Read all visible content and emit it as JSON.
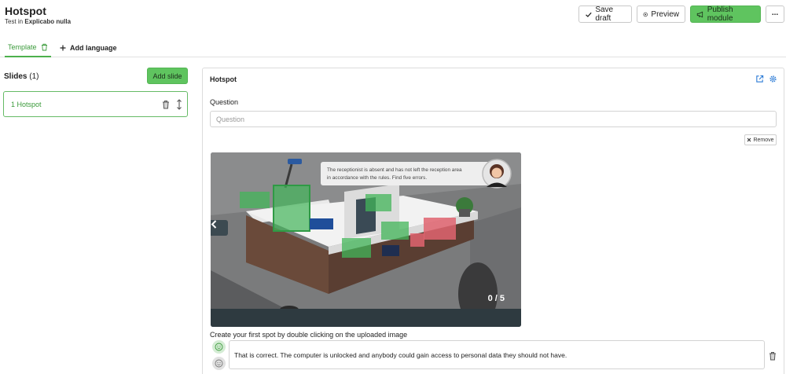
{
  "header": {
    "title": "Hotspot",
    "subtitle_prefix": "Test in",
    "subtitle_course": "Explicabo nulla",
    "save_draft": "Save draft",
    "preview": "Preview",
    "publish": "Publish module",
    "more": "..."
  },
  "tabs": {
    "template": "Template",
    "add_language": "Add language"
  },
  "sidebar": {
    "slides_label": "Slides",
    "slides_count": "(1)",
    "add_slide": "Add slide",
    "items": [
      {
        "label": "1 Hotspot"
      }
    ]
  },
  "editor": {
    "title": "Hotspot",
    "question_label": "Question",
    "question_value": "",
    "question_placeholder": "Question",
    "remove": "Remove",
    "image_caption": "The receptionist is absent and has not left the reception area in accordance with the rules. Find five errors.",
    "image_caption_line1": "The receptionist is absent and has not left the reception area",
    "image_caption_line2": "in accordance with the rules. Find five errors.",
    "counter": "0 / 5",
    "hint": "Create your first spot by double clicking on the uploaded image",
    "feedback_text": "That is correct. The computer is unlocked and anybody could gain access to personal data they should not have."
  },
  "colors": {
    "accent_green": "#5fc45f",
    "tab_green": "#3a9a3a",
    "hotspot_green": "#43b55a",
    "hotspot_red": "#e06470",
    "link_blue": "#2b7bd6"
  },
  "icons": {
    "save": "check-icon",
    "preview": "eye-icon",
    "publish": "megaphone-icon",
    "template_delete": "trash-icon",
    "add_language": "plus-icon",
    "slide_delete": "trash-icon",
    "slide_drag": "drag-handle-icon",
    "open_external": "external-link-icon",
    "settings": "gear-icon",
    "prev": "chevron-left-icon",
    "feedback_positive": "smiley-icon",
    "feedback_neutral": "neutral-face-icon",
    "feedback_delete": "trash-icon"
  }
}
